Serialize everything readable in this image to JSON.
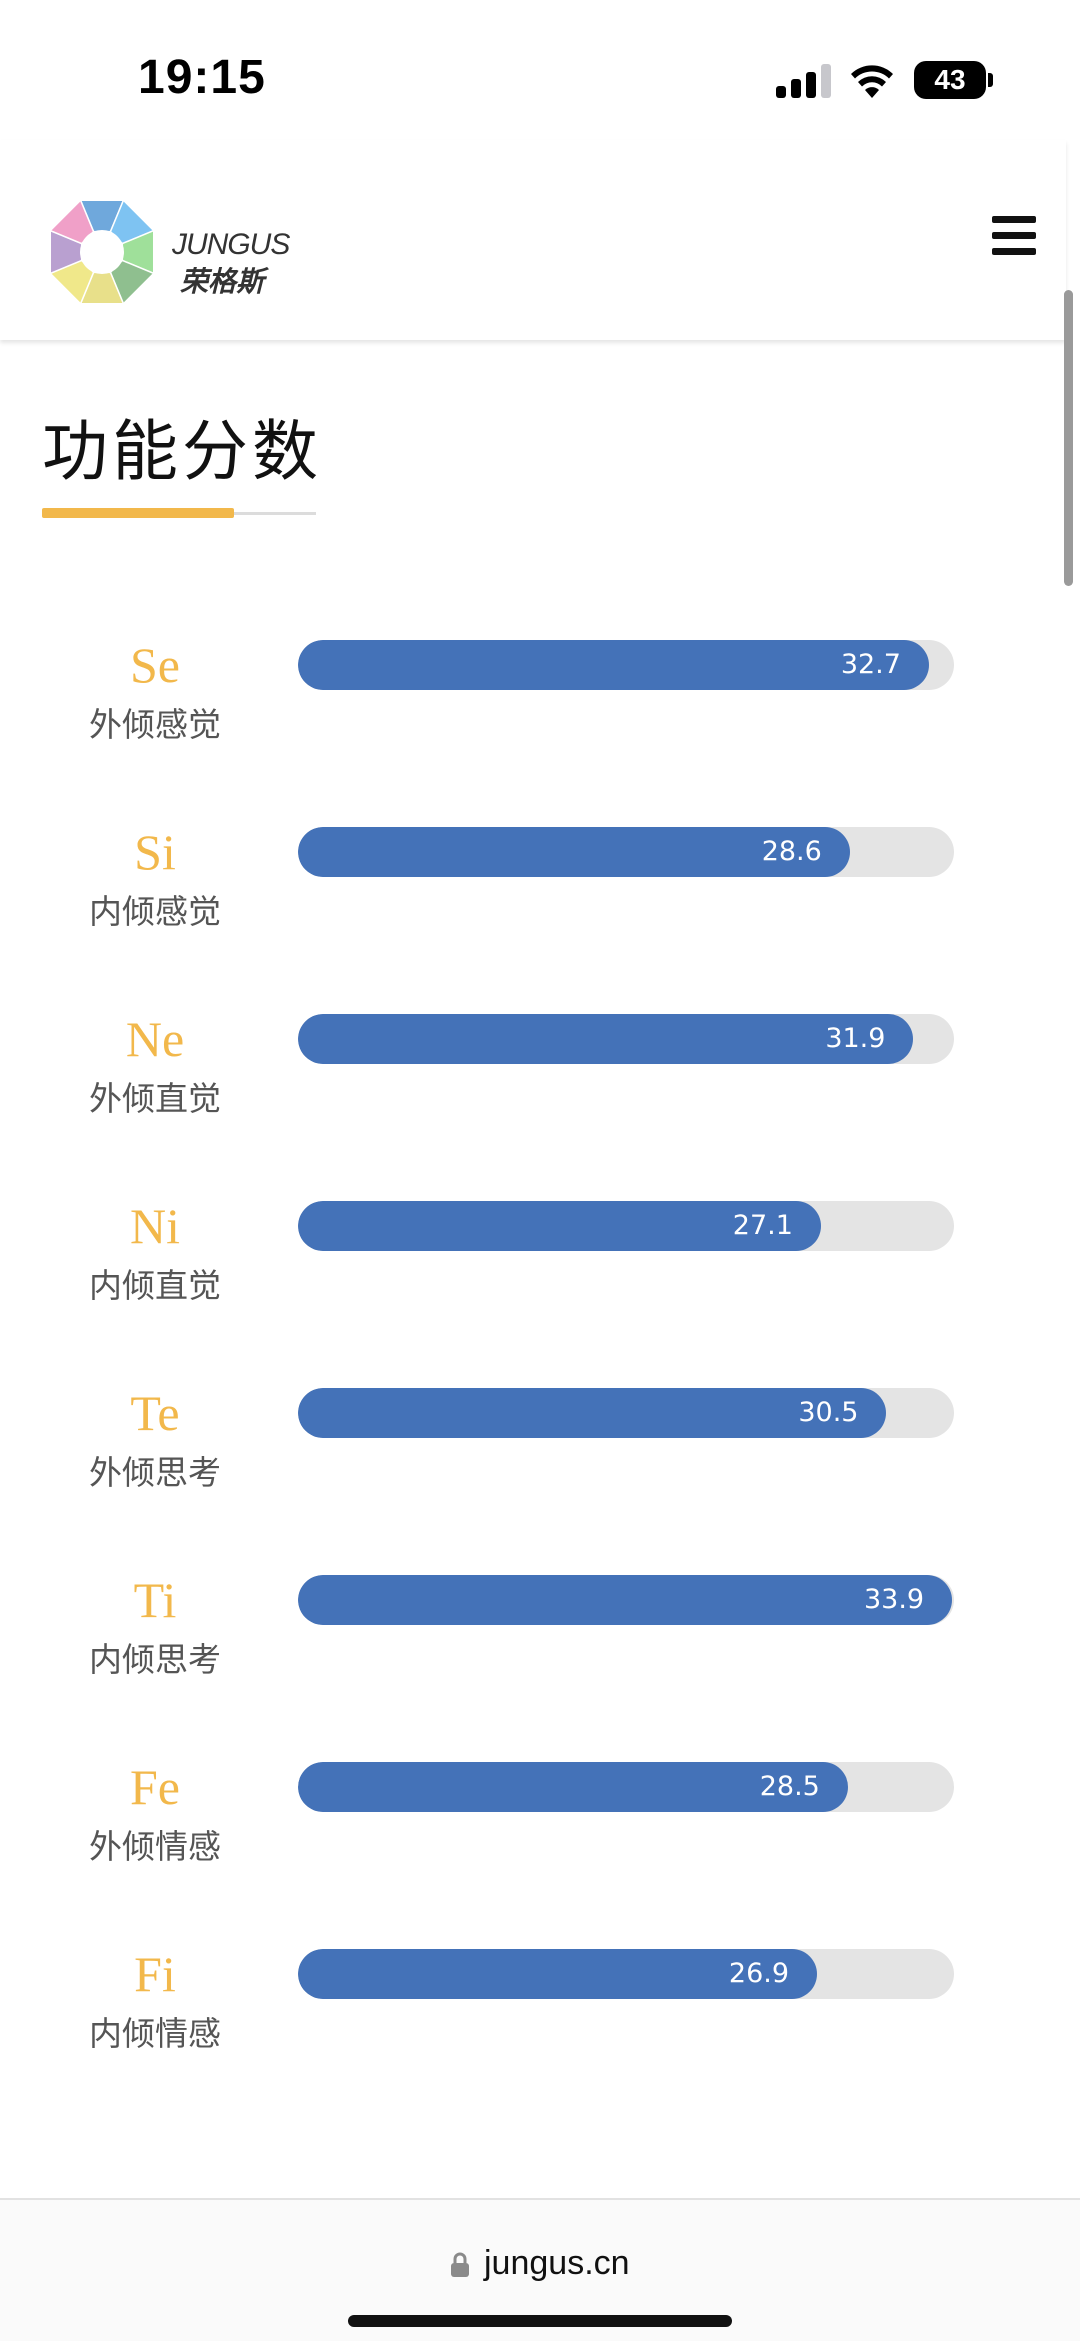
{
  "status_bar": {
    "time": "19:15",
    "battery": "43"
  },
  "header": {
    "logo_en": "JUNGUS",
    "logo_cn": "荣格斯",
    "logo_colors": [
      "#6fa8dc",
      "#7ec3f2",
      "#9fe09a",
      "#8fbf8f",
      "#e8e08a",
      "#f0e88a",
      "#b9a0d0",
      "#f0a0c8"
    ]
  },
  "main": {
    "title": "功能分数",
    "scale_max": 34.0,
    "scores": [
      {
        "code": "Se",
        "name": "外倾感觉",
        "value": 32.7
      },
      {
        "code": "Si",
        "name": "内倾感觉",
        "value": 28.6
      },
      {
        "code": "Ne",
        "name": "外倾直觉",
        "value": 31.9
      },
      {
        "code": "Ni",
        "name": "内倾直觉",
        "value": 27.1
      },
      {
        "code": "Te",
        "name": "外倾思考",
        "value": 30.5
      },
      {
        "code": "Ti",
        "name": "内倾思考",
        "value": 33.9
      },
      {
        "code": "Fe",
        "name": "外倾情感",
        "value": 28.5
      },
      {
        "code": "Fi",
        "name": "内倾情感",
        "value": 26.9
      }
    ]
  },
  "browser": {
    "url": "jungus.cn"
  },
  "colors": {
    "accent": "#f2b84b",
    "bar": "#4472b8",
    "track": "#e4e4e4"
  }
}
